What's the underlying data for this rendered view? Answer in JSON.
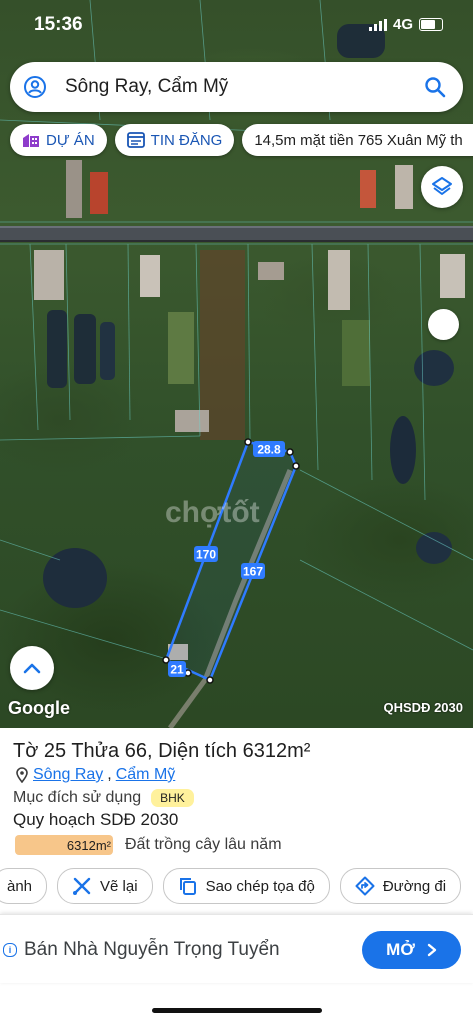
{
  "status_bar": {
    "time": "15:36",
    "network": "4G",
    "battery_level": "4"
  },
  "search": {
    "query": "Sông Ray, Cẩm Mỹ"
  },
  "chips": [
    {
      "label": "DỰ ÁN"
    },
    {
      "label": "TIN ĐĂNG"
    },
    {
      "label": "14,5m mặt tiền 765 Xuân Mỹ th"
    }
  ],
  "map": {
    "edge_labels": {
      "top": "28.8",
      "left": "170",
      "right": "167",
      "bottom": "21"
    },
    "attribution": "Google",
    "plan_label": "QHSDĐ 2030",
    "watermark": "chợtốt"
  },
  "parcel": {
    "title": "Tờ 25 Thửa 66, Diện tích 6312m²",
    "address_part1": "Sông Ray",
    "address_sep": ",",
    "address_part2": "Cẩm Mỹ",
    "purpose_label": "Mục đích sử dụng",
    "purpose_code": "BHK",
    "planning_label": "Quy hoạch SDĐ 2030",
    "planning_area": "6312m²",
    "planning_desc": "Đất trồng cây lâu năm"
  },
  "actions": [
    {
      "label": "ành"
    },
    {
      "label": "Vẽ lại"
    },
    {
      "label": "Sao chép tọa độ"
    },
    {
      "label": "Đường đi"
    }
  ],
  "ad": {
    "text": "Bán Nhà Nguyễn Trọng Tuyển",
    "button": "MỞ"
  }
}
